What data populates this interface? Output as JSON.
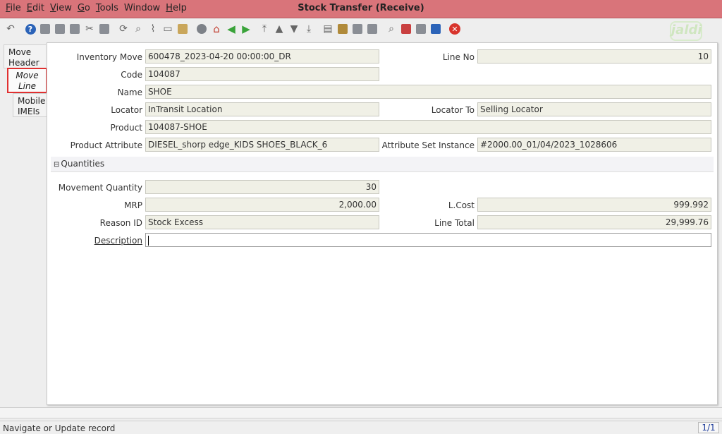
{
  "window": {
    "title": "Stock Transfer (Receive)"
  },
  "menu": [
    {
      "u": "F",
      "rest": "ile"
    },
    {
      "u": "E",
      "rest": "dit"
    },
    {
      "u": "V",
      "rest": "iew"
    },
    {
      "u": "G",
      "rest": "o"
    },
    {
      "u": "T",
      "rest": "ools"
    },
    {
      "u": "",
      "rest": "Window"
    },
    {
      "u": "H",
      "rest": "elp"
    }
  ],
  "logo": {
    "text": "jaldi"
  },
  "tabs": {
    "header": "Move Header",
    "line": "Move Line",
    "imeis": "Mobile IMEIs"
  },
  "fields": {
    "inventory_move": {
      "label": "Inventory Move",
      "value": "600478_2023-04-20 00:00:00_DR"
    },
    "line_no": {
      "label": "Line No",
      "value": "10"
    },
    "code": {
      "label": "Code",
      "value": "104087"
    },
    "name": {
      "label": "Name",
      "value": "SHOE"
    },
    "locator": {
      "label": "Locator",
      "value": "InTransit Location"
    },
    "locator_to": {
      "label": "Locator To",
      "value": "Selling Locator"
    },
    "product": {
      "label": "Product",
      "value": "104087-SHOE"
    },
    "product_attribute": {
      "label": "Product Attribute",
      "value": "DIESEL_shorp edge_KIDS SHOES_BLACK_6"
    },
    "attribute_set_instance": {
      "label": "Attribute Set Instance",
      "value": "#2000.00_01/04/2023_1028606"
    },
    "movement_quantity": {
      "label": "Movement Quantity",
      "value": "30"
    },
    "mrp": {
      "label": "MRP",
      "value": "2,000.00"
    },
    "lcost": {
      "label": "L.Cost",
      "value": "999.992"
    },
    "reason_id": {
      "label": "Reason ID",
      "value": "Stock Excess"
    },
    "line_total": {
      "label": "Line Total",
      "value": "29,999.76"
    },
    "description": {
      "label": "Description",
      "value": ""
    }
  },
  "section": {
    "quantities": "Quantities"
  },
  "status": {
    "text": "Navigate or Update record",
    "page": "1/1"
  },
  "colors": {
    "titlebar": "#d9747a",
    "readonly_field": "#f0f0e6",
    "active_tab_border": "#e03030"
  }
}
